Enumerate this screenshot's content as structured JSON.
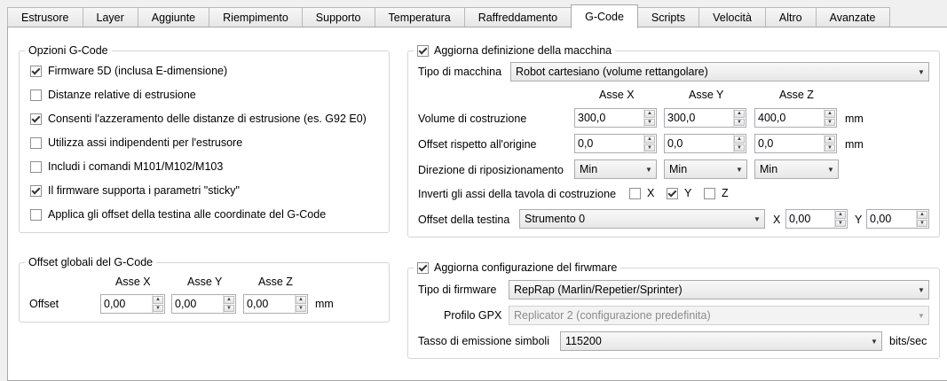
{
  "tabs": [
    "Estrusore",
    "Layer",
    "Aggiunte",
    "Riempimento",
    "Supporto",
    "Temperatura",
    "Raffreddamento",
    "G-Code",
    "Scripts",
    "Velocità",
    "Altro",
    "Avanzate"
  ],
  "active_tab": "G-Code",
  "gcode_options": {
    "title": "Opzioni G-Code",
    "items": [
      {
        "label": "Firmware 5D (inclusa E-dimensione)",
        "checked": true
      },
      {
        "label": "Distanze relative di estrusione",
        "checked": false
      },
      {
        "label": "Consenti l'azzeramento delle distanze di estrusione (es. G92 E0)",
        "checked": true
      },
      {
        "label": "Utilizza assi indipendenti per l'estrusore",
        "checked": false
      },
      {
        "label": "Includi i comandi M101/M102/M103",
        "checked": false
      },
      {
        "label": "Il firmware supporta i parametri \"sticky\"",
        "checked": true
      },
      {
        "label": "Applica gli offset della testina alle coordinate del G-Code",
        "checked": false
      }
    ]
  },
  "global_offsets": {
    "title": "Offset globali del G-Code",
    "axis_x": "Asse X",
    "axis_y": "Asse Y",
    "axis_z": "Asse Z",
    "offset_label": "Offset",
    "x": "0,00",
    "y": "0,00",
    "z": "0,00",
    "unit": "mm"
  },
  "machine": {
    "title": "Aggiorna definizione della macchina",
    "checked": true,
    "type_label": "Tipo di macchina",
    "type_value": "Robot cartesiano (volume rettangolare)",
    "axis_x": "Asse X",
    "axis_y": "Asse Y",
    "axis_z": "Asse Z",
    "volume_label": "Volume di costruzione",
    "volume_x": "300,0",
    "volume_y": "300,0",
    "volume_z": "400,0",
    "origin_label": "Offset rispetto all'origine",
    "origin_x": "0,0",
    "origin_y": "0,0",
    "origin_z": "0,0",
    "unit": "mm",
    "homing_label": "Direzione di riposizionamento",
    "homing_x": "Min",
    "homing_y": "Min",
    "homing_z": "Min",
    "invert_label": "Inverti gli assi della tavola di costruzione",
    "invert_x_label": "X",
    "invert_y_label": "Y",
    "invert_z_label": "Z",
    "invert_x": false,
    "invert_y": true,
    "invert_z": false,
    "head_offset_label": "Offset della testina",
    "head_tool": "Strumento 0",
    "head_x_label": "X",
    "head_x": "0,00",
    "head_y_label": "Y",
    "head_y": "0,00"
  },
  "firmware": {
    "title": "Aggiorna configurazione del firwmare",
    "checked": true,
    "type_label": "Tipo di firmware",
    "type_value": "RepRap (Marlin/Repetier/Sprinter)",
    "gpx_label": "Profilo GPX",
    "gpx_value": "Replicator 2 (configurazione predefinita)",
    "baud_label": "Tasso di emissione simboli",
    "baud_value": "115200",
    "baud_unit": "bits/sec"
  }
}
